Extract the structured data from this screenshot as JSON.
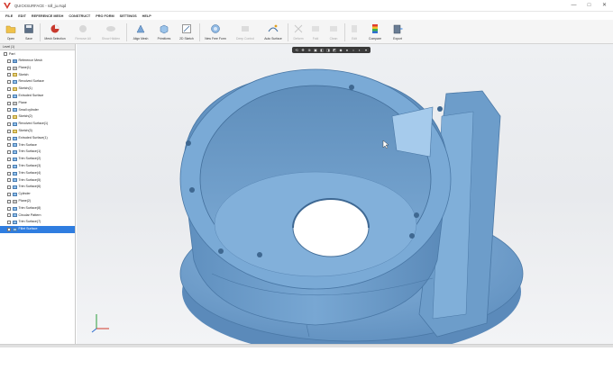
{
  "window": {
    "title": "QUICKSURFACE - roll_ju.rsqd",
    "minimize_glyph": "—",
    "maximize_glyph": "□",
    "close_glyph": "✕"
  },
  "menu": [
    "FILE",
    "EDIT",
    "REFERENCE MESH",
    "CONSTRUCT",
    "PRO FORM",
    "SETTINGS",
    "HELP"
  ],
  "toolbar": [
    {
      "label": "Open",
      "icon": "folder-icon",
      "enabled": true
    },
    {
      "label": "Save",
      "icon": "save-icon",
      "enabled": true
    },
    {
      "label": "Mesh Selection",
      "icon": "mesh-selection-icon",
      "enabled": true
    },
    {
      "label": "Remove All",
      "icon": "remove-all-icon",
      "enabled": false
    },
    {
      "label": "Show Hidden",
      "icon": "show-hidden-icon",
      "enabled": false
    },
    {
      "label": "Align Mesh",
      "icon": "align-mesh-icon",
      "enabled": true
    },
    {
      "label": "Primitives",
      "icon": "primitives-icon",
      "enabled": true
    },
    {
      "label": "2D Sketch",
      "icon": "sketch-icon",
      "enabled": true
    },
    {
      "label": "New Free Form",
      "icon": "free-form-icon",
      "enabled": true
    },
    {
      "label": "Deep Control",
      "icon": "deep-control-icon",
      "enabled": false
    },
    {
      "label": "Auto Surface",
      "icon": "auto-surface-icon",
      "enabled": true
    },
    {
      "label": "Deform",
      "icon": "deform-icon",
      "enabled": false
    },
    {
      "label": "Fold",
      "icon": "fold-icon",
      "enabled": false
    },
    {
      "label": "Clean",
      "icon": "clean-icon",
      "enabled": false
    },
    {
      "label": "Edit",
      "icon": "edit-icon",
      "enabled": false
    },
    {
      "label": "Compare",
      "icon": "compare-icon",
      "enabled": true
    },
    {
      "label": "Export",
      "icon": "export-icon",
      "enabled": true
    }
  ],
  "tree": {
    "header": "Level (1)",
    "root": "Part",
    "items": [
      {
        "label": "Reference Mesh",
        "type": "mesh"
      },
      {
        "label": "Plane(1)",
        "type": "plane"
      },
      {
        "label": "Sketch",
        "type": "sketch"
      },
      {
        "label": "Revolved Surface",
        "type": "surf"
      },
      {
        "label": "Sketch(1)",
        "type": "sketch"
      },
      {
        "label": "Extruded Surface",
        "type": "surf"
      },
      {
        "label": "Plane",
        "type": "plane"
      },
      {
        "label": "Small cylinder",
        "type": "surf"
      },
      {
        "label": "Sketch(2)",
        "type": "sketch"
      },
      {
        "label": "Revolved Surface(1)",
        "type": "surf"
      },
      {
        "label": "Sketch(3)",
        "type": "sketch"
      },
      {
        "label": "Extruded Surface(1)",
        "type": "surf"
      },
      {
        "label": "Trim Surface",
        "type": "surf"
      },
      {
        "label": "Trim Surface(1)",
        "type": "surf"
      },
      {
        "label": "Trim Surface(2)",
        "type": "surf"
      },
      {
        "label": "Trim Surface(3)",
        "type": "surf"
      },
      {
        "label": "Trim Surface(4)",
        "type": "surf"
      },
      {
        "label": "Trim Surface(5)",
        "type": "surf"
      },
      {
        "label": "Trim Surface(6)",
        "type": "surf"
      },
      {
        "label": "Cylinder",
        "type": "surf"
      },
      {
        "label": "Plane(2)",
        "type": "plane"
      },
      {
        "label": "Trim Surface(8)",
        "type": "surf"
      },
      {
        "label": "Circular Pattern",
        "type": "surf"
      },
      {
        "label": "Trim Surface(7)",
        "type": "surf"
      },
      {
        "label": "Fillet Surface",
        "type": "surf",
        "selected": true
      }
    ]
  },
  "view_toolbar_icons": [
    "rotate-icon",
    "pan-icon",
    "zoom-icon",
    "fit-icon",
    "front-view-icon",
    "top-view-icon",
    "right-view-icon",
    "iso-view-icon",
    "shading-icon",
    "wireframe-icon",
    "section-icon",
    "display-options-icon"
  ],
  "colors": {
    "model": "#6f9fcc",
    "model_dark": "#4f7ea9",
    "model_light": "#8db8df",
    "selection": "#2f7de0"
  }
}
